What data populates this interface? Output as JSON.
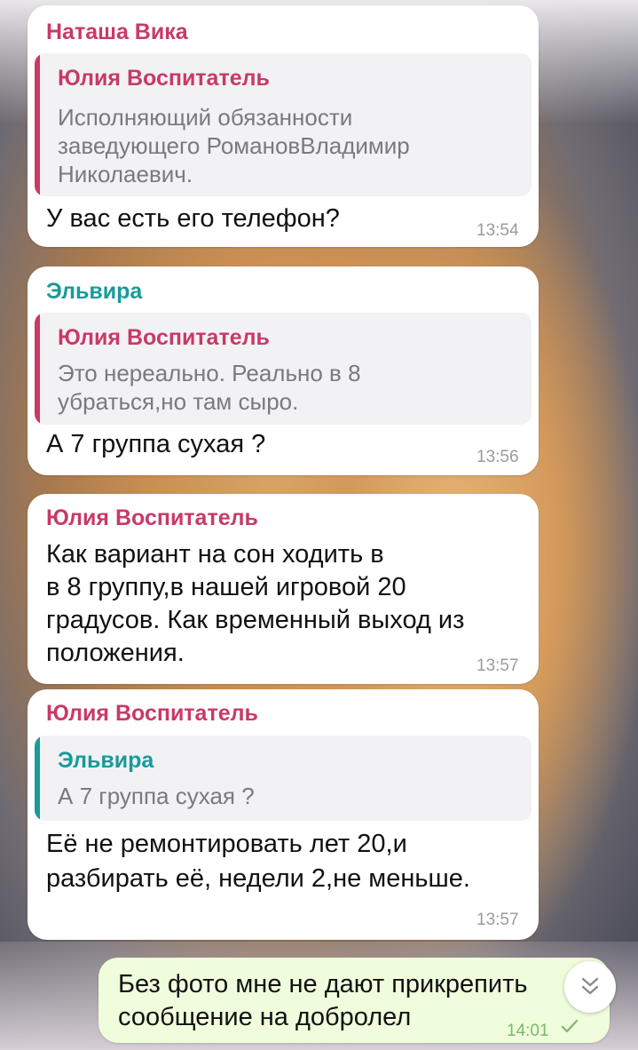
{
  "messages": [
    {
      "sender": "Наташа Вика",
      "reply": {
        "name": "Юлия Воспитатель",
        "lines": [
          "Исполняющий обязанности",
          "заведующего РомановВладимир",
          "Николаевич."
        ]
      },
      "text": [
        "У вас есть его телефон?"
      ],
      "time": "13:54"
    },
    {
      "sender": "Эльвира",
      "reply": {
        "name": "Юлия Воспитатель",
        "lines": [
          "Это нереально. Реально в 8",
          "убраться,но там сыро."
        ]
      },
      "text": [
        "А 7 группа сухая ?"
      ],
      "time": "13:56"
    },
    {
      "sender": "Юлия Воспитатель",
      "text": [
        "Как вариант на сон ходить в",
        "в 8 группу,в нашей игровой 20",
        "градусов. Как временный выход из",
        "положения."
      ],
      "time": "13:57"
    },
    {
      "sender": "Юлия Воспитатель",
      "reply": {
        "name": "Эльвира",
        "lines": [
          "А 7 группа сухая ?"
        ]
      },
      "text": [
        "Её не ремонтировать лет 20,и",
        "разбирать её, недели 2,не меньше."
      ],
      "time": "13:57"
    }
  ],
  "outgoing": {
    "text": [
      "Без фото мне не дают прикрепить",
      "сообщение на добролел"
    ],
    "time": "14:01",
    "status_icon": "check-icon"
  },
  "colors": {
    "pink": "#c83a66",
    "teal": "#1a9a9a",
    "outgoing_bg": "#effddc"
  },
  "icons": {
    "scroll_down": "chevron-double-down-icon"
  }
}
